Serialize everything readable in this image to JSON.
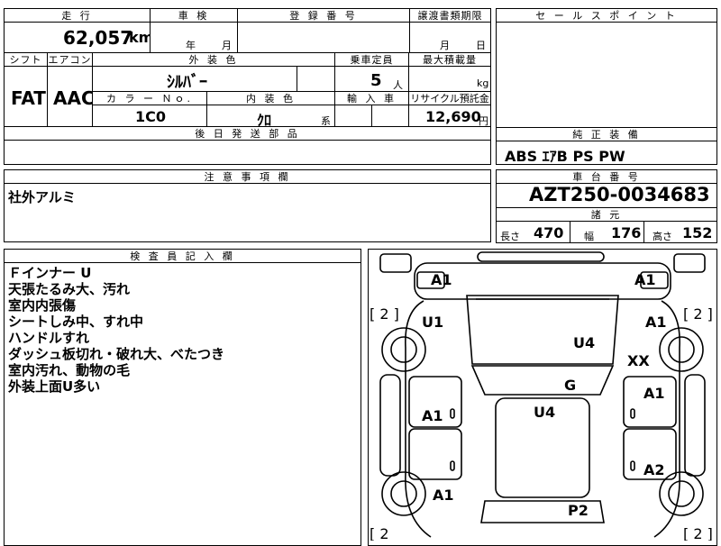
{
  "header": {
    "mileage_label": "走 行",
    "mileage_value": "62,057",
    "mileage_unit": "km",
    "inspection_label": "車 検",
    "year_unit": "年",
    "month_unit": "月",
    "registration_label": "登 録 番 号",
    "transfer_label": "譲渡書類期限",
    "transfer_month": "月",
    "transfer_day": "日"
  },
  "specs": {
    "shift_label": "シフト",
    "shift_value": "FAT",
    "ac_label": "エアコン",
    "ac_value": "AAC",
    "exterior_color_label": "外 装 色",
    "exterior_color_value": "ｼﾙﾊﾞｰ",
    "color_no_label": "カ ラ ー Ｎｏ.",
    "color_no_value": "1C0",
    "interior_color_label": "内 装 色",
    "interior_color_value": "ｸﾛ",
    "interior_suffix": "系",
    "capacity_label": "乗車定員",
    "capacity_value": "5",
    "capacity_unit": "人",
    "max_load_label": "最大積載量",
    "max_load_unit": "kg",
    "import_label": "輸 入 車",
    "recycle_label": "リサイクル預託金",
    "recycle_value": "12,690",
    "recycle_unit": "円",
    "shipping_label": "後 日 発 送 部 品"
  },
  "sales": {
    "label": "セ ー ル ス ポ イ ン ト",
    "equipment_label": "純 正 装 備",
    "equipment_value": "ABS ｴｱB PS PW"
  },
  "notes": {
    "label": "注 意 事 項 欄",
    "value": "社外アルミ"
  },
  "chassis": {
    "label": "車 台 番 号",
    "value": "AZT250-0034683",
    "dims_label": "諸 元",
    "length_label": "長さ",
    "length_value": "470",
    "width_label": "幅",
    "width_value": "176",
    "height_label": "高さ",
    "height_value": "152"
  },
  "inspector": {
    "label": "検 査 員 記 入 欄",
    "lines": [
      "Ｆインナー U",
      "天張たるみ大、汚れ",
      "室内内張傷",
      "シートしみ中、すれ中",
      "ハンドルすれ",
      "ダッシュ板切れ・破れ大、べたつき",
      "室内汚れ、動物の毛",
      "外装上面U多い"
    ]
  },
  "diagram": {
    "marks": {
      "a1_front_left": "A1",
      "a1_front_right": "A1",
      "u1": "U1",
      "u4_hood": "U4",
      "a1_right_fender": "A1",
      "xx": "XX",
      "g": "G",
      "u4_roof": "U4",
      "a1_left_door": "A1",
      "a1_right_door": "A1",
      "a2_right": "A2",
      "a1_rear_left": "A1",
      "p2": "P2"
    },
    "tire_left_top": "[ 2 ]",
    "tire_right_top": "[ 2 ]",
    "tire_left_bottom": "[ 2",
    "tire_right_bottom": "[ 2 ]"
  }
}
